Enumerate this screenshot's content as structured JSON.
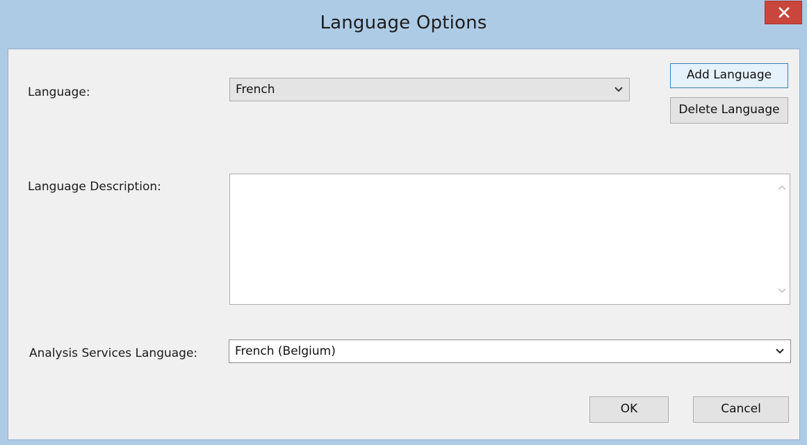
{
  "window": {
    "title": "Language Options"
  },
  "form": {
    "language_label": "Language:",
    "language_value": "French",
    "description_label": "Language Description:",
    "description_value": "",
    "as_language_label": "Analysis Services Language:",
    "as_language_value": "French (Belgium)"
  },
  "buttons": {
    "add_language": "Add Language",
    "delete_language": "Delete Language",
    "ok": "OK",
    "cancel": "Cancel"
  },
  "icons": {
    "close": "close-icon",
    "dropdown": "chevron-down-icon",
    "scroll_up": "scroll-up-icon",
    "scroll_down": "scroll-down-icon"
  },
  "colors": {
    "titlebar": "#aecbe6",
    "close_button": "#c9463d",
    "client_background": "#f0f0f0",
    "focused_button_border": "#3c7fb1"
  }
}
